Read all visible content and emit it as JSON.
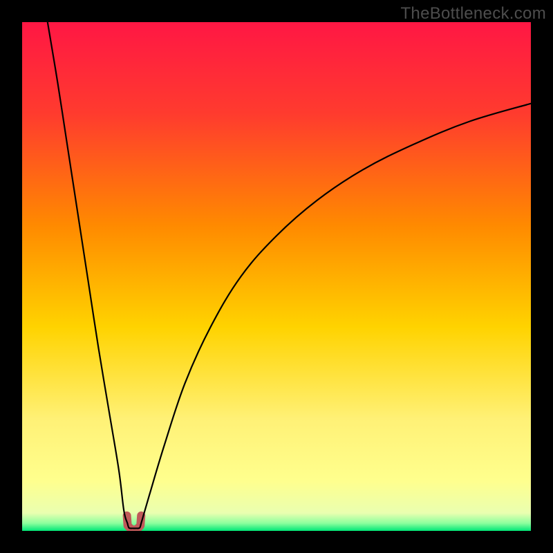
{
  "watermark": "TheBottleneck.com",
  "chart_data": {
    "type": "line",
    "title": "",
    "xlabel": "",
    "ylabel": "",
    "xlim": [
      0,
      100
    ],
    "ylim": [
      0,
      100
    ],
    "grid": false,
    "legend": false,
    "gradient_stops": [
      {
        "offset": 0,
        "color": "#ff1744"
      },
      {
        "offset": 0.18,
        "color": "#ff3b2e"
      },
      {
        "offset": 0.4,
        "color": "#ff8a00"
      },
      {
        "offset": 0.6,
        "color": "#ffd300"
      },
      {
        "offset": 0.78,
        "color": "#fff176"
      },
      {
        "offset": 0.9,
        "color": "#ffff8d"
      },
      {
        "offset": 0.965,
        "color": "#eaffb0"
      },
      {
        "offset": 0.985,
        "color": "#8cff9e"
      },
      {
        "offset": 1.0,
        "color": "#00e676"
      }
    ],
    "series": [
      {
        "name": "left-branch",
        "x": [
          5,
          7,
          9,
          11,
          13,
          15,
          17,
          19,
          20,
          20.7
        ],
        "values": [
          100,
          88,
          75,
          62,
          49,
          36,
          24,
          12,
          4,
          1.5
        ]
      },
      {
        "name": "notch",
        "x": [
          20.7,
          21.0,
          21.7,
          22.4,
          23.1,
          23.4
        ],
        "values": [
          1.5,
          0.6,
          0.5,
          0.5,
          0.6,
          1.5
        ]
      },
      {
        "name": "right-branch",
        "x": [
          23.4,
          25,
          28,
          32,
          37,
          43,
          50,
          58,
          67,
          77,
          88,
          100
        ],
        "values": [
          1.5,
          7,
          17,
          29,
          40,
          50,
          58,
          65,
          71,
          76,
          80.5,
          84
        ]
      }
    ],
    "notch_marker": {
      "x_center": 22.0,
      "width": 2.8,
      "height": 3.0,
      "color": "#c05a5a"
    }
  }
}
